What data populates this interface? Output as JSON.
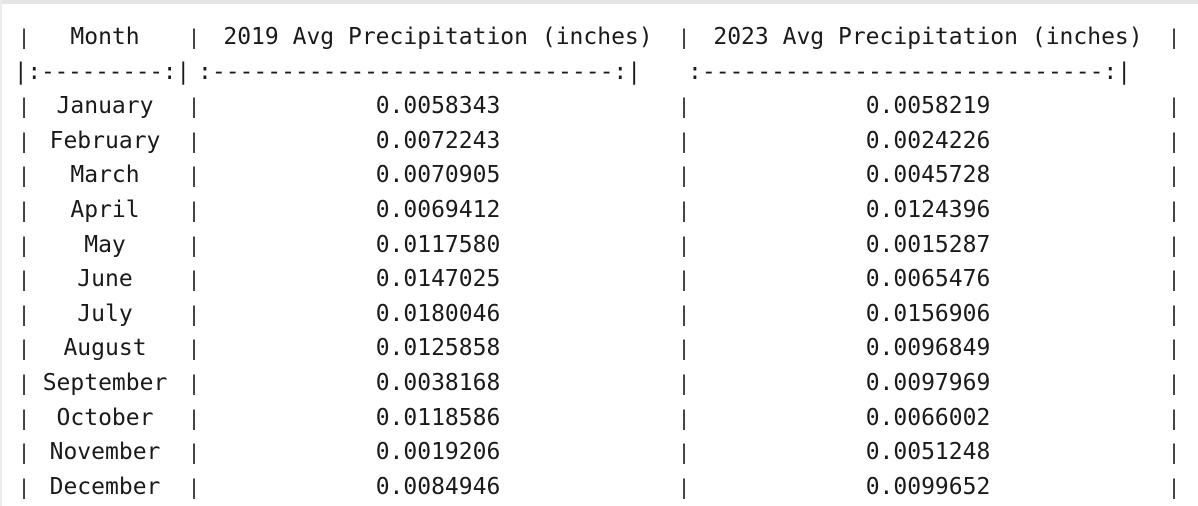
{
  "table": {
    "pipe": "|",
    "headers": [
      "Month",
      "2019 Avg Precipitation (inches)",
      "2023 Avg Precipitation (inches)"
    ],
    "separator": [
      ":---------:",
      ":-----------------------------:",
      ":-----------------------------:"
    ],
    "rows": [
      [
        "January",
        "0.0058343",
        "0.0058219"
      ],
      [
        "February",
        "0.0072243",
        "0.0024226"
      ],
      [
        "March",
        "0.0070905",
        "0.0045728"
      ],
      [
        "April",
        "0.0069412",
        "0.0124396"
      ],
      [
        "May",
        "0.0117580",
        "0.0015287"
      ],
      [
        "June",
        "0.0147025",
        "0.0065476"
      ],
      [
        "July",
        "0.0180046",
        "0.0156906"
      ],
      [
        "August",
        "0.0125858",
        "0.0096849"
      ],
      [
        "September",
        "0.0038168",
        "0.0097969"
      ],
      [
        "October",
        "0.0118586",
        "0.0066002"
      ],
      [
        "November",
        "0.0019206",
        "0.0051248"
      ],
      [
        "December",
        "0.0084946",
        "0.0099652"
      ]
    ]
  }
}
